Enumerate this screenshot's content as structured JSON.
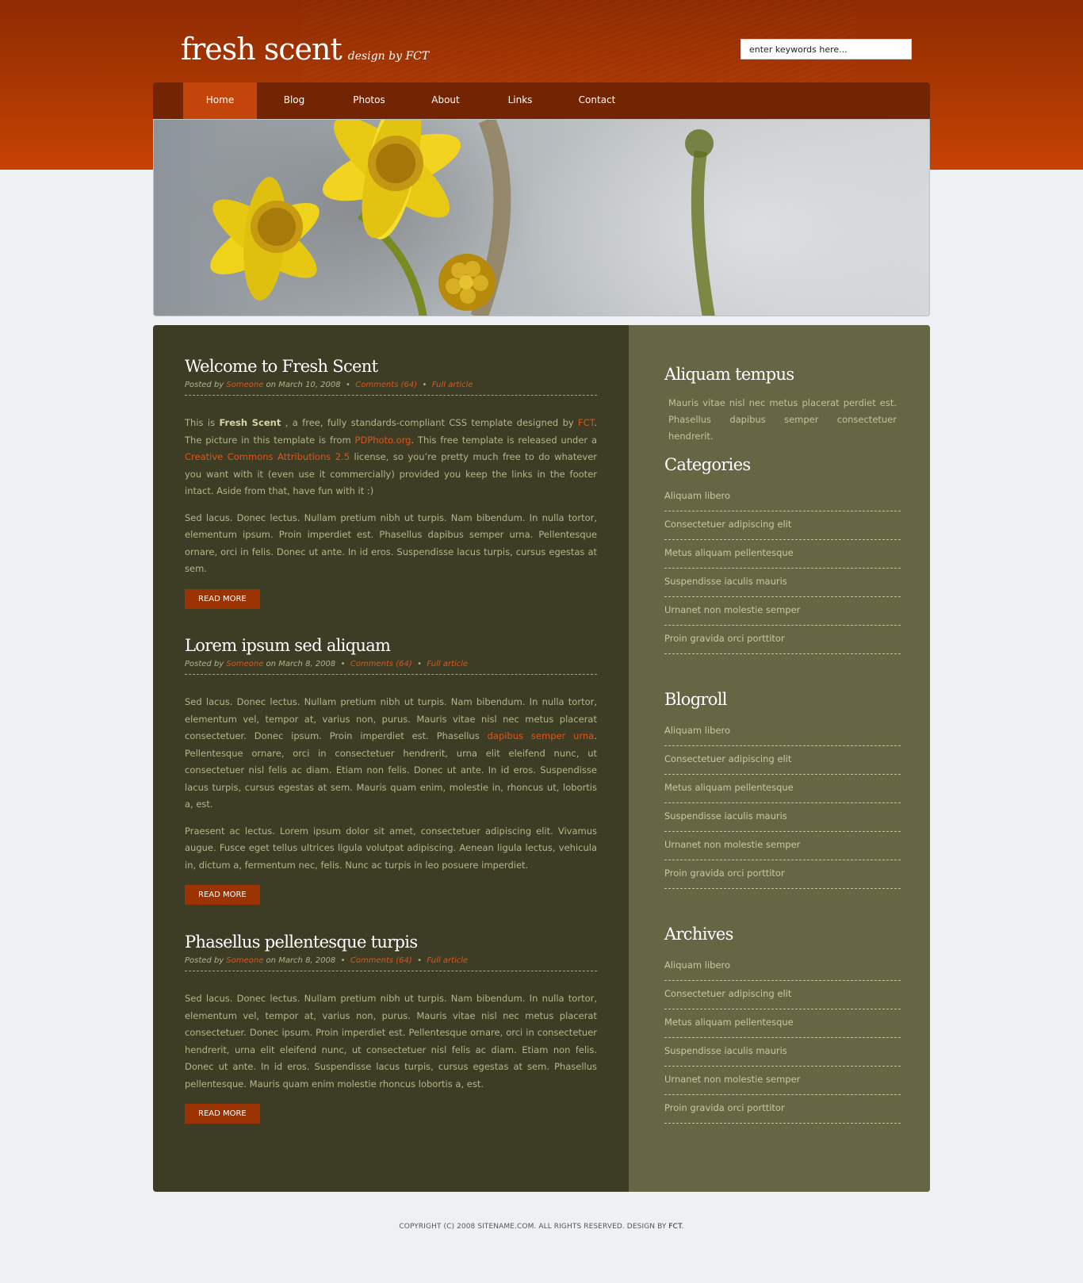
{
  "header": {
    "title": "fresh scent",
    "subtitle": "design by FCT",
    "search_placeholder": "enter keywords here..."
  },
  "nav": {
    "items": [
      {
        "label": "Home",
        "active": true
      },
      {
        "label": "Blog"
      },
      {
        "label": "Photos"
      },
      {
        "label": "About"
      },
      {
        "label": "Links"
      },
      {
        "label": "Contact"
      }
    ]
  },
  "posts": [
    {
      "title": "Welcome to Fresh Scent",
      "meta": {
        "posted_by": "Posted by ",
        "author": "Someone",
        "date": " on March 10, 2008",
        "sep": "  •  ",
        "comments": "Comments (64)",
        "full": "Full article"
      },
      "p1": {
        "t1": "This is ",
        "strong": "Fresh Scent",
        "t2": " , a free, fully standards-compliant CSS template designed by ",
        "link1": "FCT",
        "t3": ". The picture in this template is from ",
        "link2": "PDPhoto.org",
        "t4": ". This free template is released under a ",
        "link3": "Creative Commons Attributions 2.5",
        "t5": " license, so you’re pretty much free to do whatever you want with it (even use it commercially) provided you keep the links in the footer intact. Aside from that, have fun with it :)"
      },
      "p2": "Sed lacus. Donec lectus. Nullam pretium nibh ut turpis. Nam bibendum. In nulla tortor, elementum ipsum. Proin imperdiet est. Phasellus dapibus semper urna. Pellentesque ornare, orci in felis. Donec ut ante. In id eros. Suspendisse lacus turpis, cursus egestas at sem.",
      "read_more": "READ MORE"
    },
    {
      "title": "Lorem ipsum sed aliquam",
      "meta": {
        "posted_by": "Posted by ",
        "author": "Someone",
        "date": " on March 8, 2008",
        "sep": "  •  ",
        "comments": "Comments (64)",
        "full": "Full article"
      },
      "p1": {
        "t1": "Sed lacus. Donec lectus. Nullam pretium nibh ut turpis. Nam bibendum. In nulla tortor, elementum vel, tempor at, varius non, purus. Mauris vitae nisl nec metus placerat consectetuer. Donec ipsum. Proin imperdiet est. Phasellus ",
        "link1": "dapibus semper urna",
        "t2": ". Pellentesque ornare, orci in consectetuer hendrerit, urna elit eleifend nunc, ut consectetuer nisl felis ac diam. Etiam non felis. Donec ut ante. In id eros. Suspendisse lacus turpis, cursus egestas at sem. Mauris quam enim, molestie in, rhoncus ut, lobortis a, est."
      },
      "p2": "Praesent ac lectus. Lorem ipsum dolor sit amet, consectetuer adipiscing elit. Vivamus augue. Fusce eget tellus ultrices ligula volutpat adipiscing. Aenean ligula lectus, vehicula in, dictum a, fermentum nec, felis. Nunc ac turpis in leo posuere imperdiet.",
      "read_more": "READ MORE"
    },
    {
      "title": "Phasellus pellentesque turpis",
      "meta": {
        "posted_by": "Posted by ",
        "author": "Someone",
        "date": " on March 8, 2008",
        "sep": "  •  ",
        "comments": "Comments (64)",
        "full": "Full article"
      },
      "p1": "Sed lacus. Donec lectus. Nullam pretium nibh ut turpis. Nam bibendum. In nulla tortor, elementum vel, tempor at, varius non, purus. Mauris vitae nisl nec metus placerat consectetuer. Donec ipsum. Proin imperdiet est. Pellentesque ornare, orci in consectetuer hendrerit, urna elit eleifend nunc, ut consectetuer nisl felis ac diam. Etiam non felis. Donec ut ante. In id eros. Suspendisse lacus turpis, cursus egestas at sem. Phasellus pellentesque. Mauris quam enim molestie rhoncus lobortis a, est.",
      "read_more": "READ MORE"
    }
  ],
  "sidebar": {
    "intro": {
      "title": "Aliquam tempus",
      "text": "Mauris vitae nisl nec metus placerat perdiet est. Phasellus dapibus semper consectetuer hendrerit."
    },
    "categories": {
      "title": "Categories",
      "items": [
        "Aliquam libero",
        "Consectetuer adipiscing elit",
        "Metus aliquam pellentesque",
        "Suspendisse iaculis mauris",
        "Urnanet non molestie semper",
        "Proin gravida orci porttitor"
      ]
    },
    "blogroll": {
      "title": "Blogroll",
      "items": [
        "Aliquam libero",
        "Consectetuer adipiscing elit",
        "Metus aliquam pellentesque",
        "Suspendisse iaculis mauris",
        "Urnanet non molestie semper",
        "Proin gravida orci porttitor"
      ]
    },
    "archives": {
      "title": "Archives",
      "items": [
        "Aliquam libero",
        "Consectetuer adipiscing elit",
        "Metus aliquam pellentesque",
        "Suspendisse iaculis mauris",
        "Urnanet non molestie semper",
        "Proin gravida orci porttitor"
      ]
    }
  },
  "footer": {
    "text": "COPYRIGHT (C) 2008 SITENAME.COM. ALL RIGHTS RESERVED. DESIGN BY ",
    "fct": "FCT",
    "dot": "."
  },
  "colors": {
    "header_orange": "#a63602",
    "nav_brown": "#722403",
    "nav_active": "#c3450c",
    "content_dark": "#3d3d26",
    "sidebar_olive": "#666644",
    "link_orange": "#e0541a",
    "button_red": "#9c3303"
  }
}
